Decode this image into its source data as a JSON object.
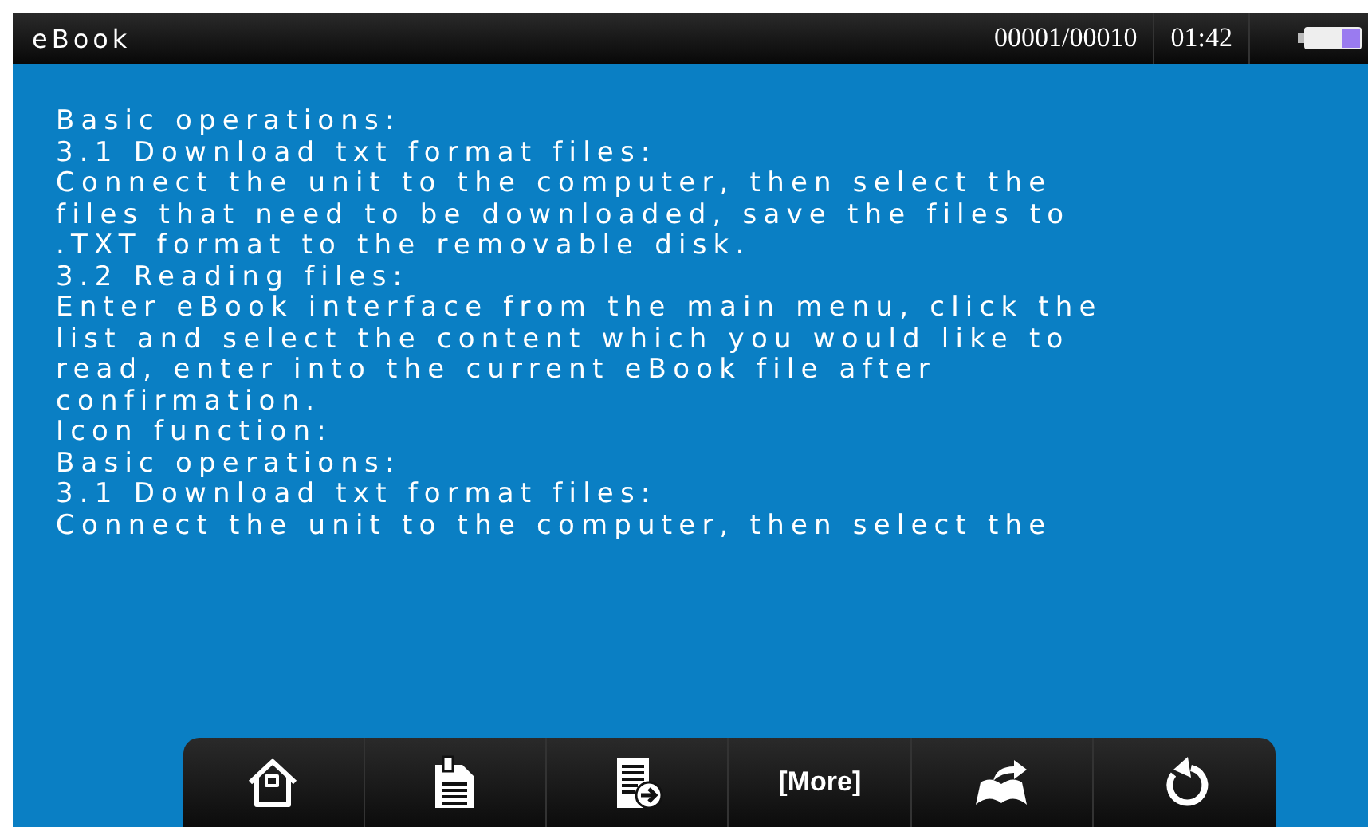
{
  "title_bar": {
    "title": "eBook",
    "page_counter": "00001/00010",
    "time": "01:42"
  },
  "text_lines": [
    "Basic operations:",
    "3.1 Download txt format files:",
    "Connect the unit to the computer, then select the",
    "files that need to be downloaded, save the files to",
    ".TXT format to the removable disk.",
    "3.2 Reading files:",
    "Enter eBook interface from the main menu, click the",
    "list and select the content which you would like to",
    "read, enter into the current eBook file after",
    "confirmation.",
    "Icon function:",
    "Basic operations:",
    "3.1 Download txt format files:",
    "Connect the unit to the computer, then select the"
  ],
  "toolbar": [
    {
      "kind": "home"
    },
    {
      "kind": "document"
    },
    {
      "kind": "export"
    },
    {
      "kind": "text",
      "label": "[More]"
    },
    {
      "kind": "book"
    },
    {
      "kind": "rotate"
    }
  ]
}
